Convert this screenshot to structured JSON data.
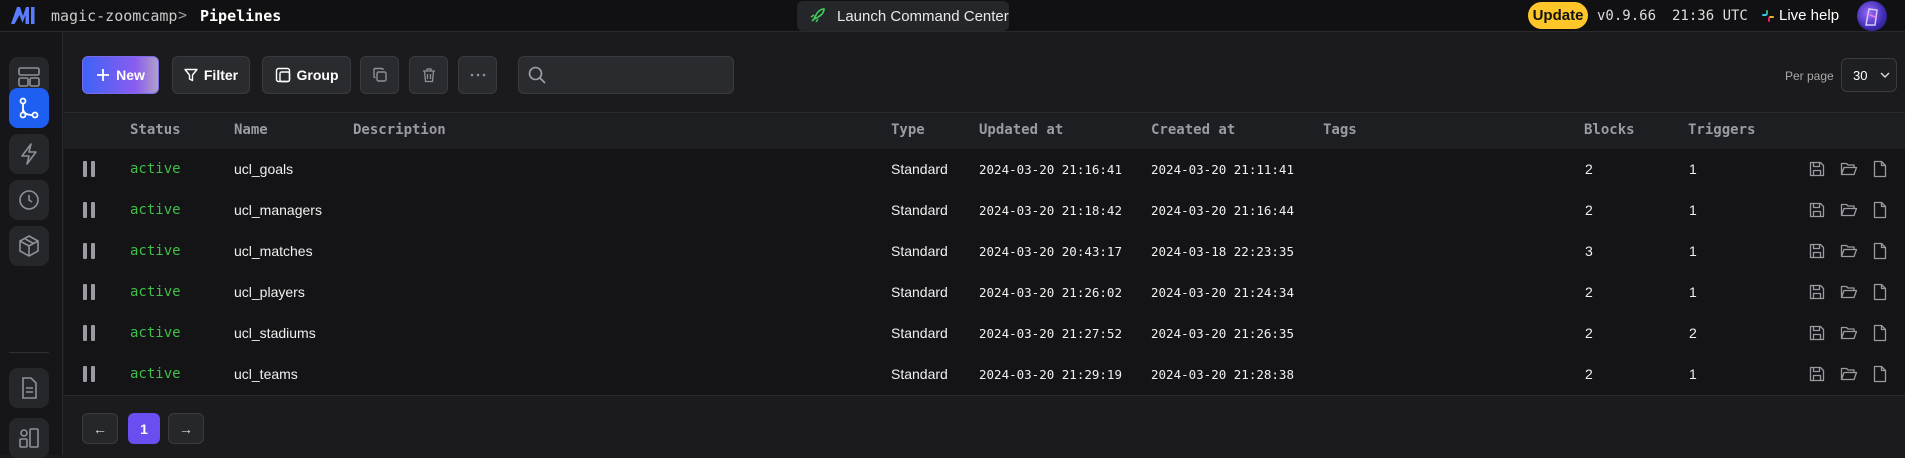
{
  "header": {
    "project": "magic-zoomcamp",
    "separator": ">",
    "current_page": "Pipelines",
    "launch_label": "Launch Command Center",
    "update_label": "Update",
    "version": "v0.9.66",
    "time": "21:36 UTC",
    "help_label": "Live help"
  },
  "toolbar": {
    "new_label": "New",
    "filter_label": "Filter",
    "group_label": "Group",
    "search_placeholder": "",
    "per_page_label": "Per page",
    "per_page_value": "30"
  },
  "table": {
    "columns": [
      "Status",
      "Name",
      "Description",
      "Type",
      "Updated at",
      "Created at",
      "Tags",
      "Blocks",
      "Triggers"
    ],
    "rows": [
      {
        "status": "active",
        "name": "ucl_goals",
        "description": "",
        "type": "Standard",
        "updated": "2024-03-20 21:16:41",
        "created": "2024-03-20 21:11:41",
        "tags": "",
        "blocks": "2",
        "triggers": "1"
      },
      {
        "status": "active",
        "name": "ucl_managers",
        "description": "",
        "type": "Standard",
        "updated": "2024-03-20 21:18:42",
        "created": "2024-03-20 21:16:44",
        "tags": "",
        "blocks": "2",
        "triggers": "1"
      },
      {
        "status": "active",
        "name": "ucl_matches",
        "description": "",
        "type": "Standard",
        "updated": "2024-03-20 20:43:17",
        "created": "2024-03-18 22:23:35",
        "tags": "",
        "blocks": "3",
        "triggers": "1"
      },
      {
        "status": "active",
        "name": "ucl_players",
        "description": "",
        "type": "Standard",
        "updated": "2024-03-20 21:26:02",
        "created": "2024-03-20 21:24:34",
        "tags": "",
        "blocks": "2",
        "triggers": "1"
      },
      {
        "status": "active",
        "name": "ucl_stadiums",
        "description": "",
        "type": "Standard",
        "updated": "2024-03-20 21:27:52",
        "created": "2024-03-20 21:26:35",
        "tags": "",
        "blocks": "2",
        "triggers": "2"
      },
      {
        "status": "active",
        "name": "ucl_teams",
        "description": "",
        "type": "Standard",
        "updated": "2024-03-20 21:29:19",
        "created": "2024-03-20 21:28:38",
        "tags": "",
        "blocks": "2",
        "triggers": "1"
      }
    ]
  },
  "pagination": {
    "prev_label": "←",
    "current_page": "1",
    "next_label": "→"
  },
  "colors": {
    "accent_blue": "#1e5ff2",
    "status_active": "#3fbf48",
    "update_yellow": "#ffc629",
    "page_purple": "#6a4ef0"
  },
  "icons": {
    "nav": [
      "dashboard-icon",
      "pipelines-icon",
      "triggers-icon",
      "history-icon",
      "blocks-icon",
      "files-icon",
      "templates-icon"
    ],
    "row_actions": [
      "save-icon",
      "folder-icon",
      "file-icon"
    ]
  }
}
